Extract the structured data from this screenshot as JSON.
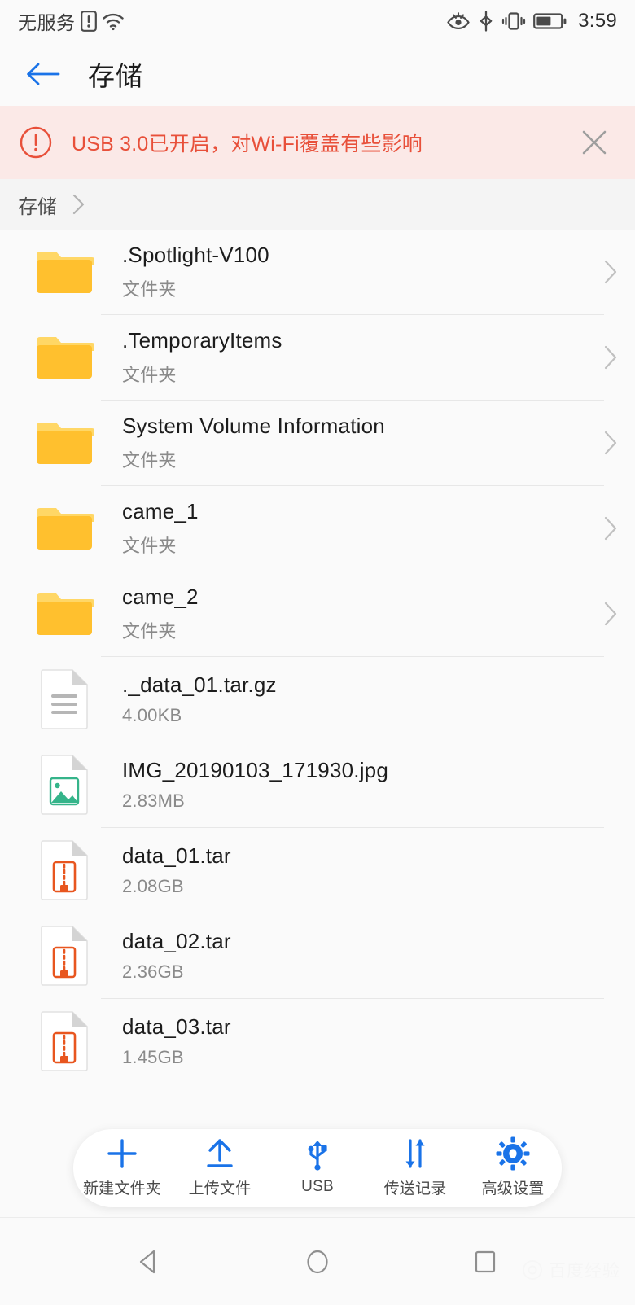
{
  "status_bar": {
    "carrier": "无服务",
    "time": "3:59",
    "icons": [
      "sim-card-alert-icon",
      "wifi-icon",
      "eye-comfort-icon",
      "bluetooth-icon",
      "vibrate-icon",
      "battery-icon"
    ]
  },
  "header": {
    "title": "存储",
    "back_icon": "back-arrow-icon"
  },
  "banner": {
    "message": "USB 3.0已开启，对Wi-Fi覆盖有些影响",
    "alert_icon": "alert-circle-icon",
    "close_icon": "close-icon",
    "text_color": "#e8503a",
    "background_color": "#fbe9e7"
  },
  "breadcrumb": {
    "items": [
      "存储"
    ],
    "chevron_icon": "chevron-right-icon"
  },
  "files": [
    {
      "name": ".Spotlight-V100",
      "sub": "文件夹",
      "kind": "folder",
      "icon": "folder-icon",
      "chevron": true
    },
    {
      "name": ".TemporaryItems",
      "sub": "文件夹",
      "kind": "folder",
      "icon": "folder-icon",
      "chevron": true
    },
    {
      "name": "System Volume Information",
      "sub": "文件夹",
      "kind": "folder",
      "icon": "folder-icon",
      "chevron": true
    },
    {
      "name": "came_1",
      "sub": "文件夹",
      "kind": "folder",
      "icon": "folder-icon",
      "chevron": true
    },
    {
      "name": "came_2",
      "sub": "文件夹",
      "kind": "folder",
      "icon": "folder-icon",
      "chevron": true
    },
    {
      "name": "._data_01.tar.gz",
      "sub": "4.00KB",
      "kind": "generic",
      "icon": "document-file-icon",
      "chevron": false
    },
    {
      "name": "IMG_20190103_171930.jpg",
      "sub": "2.83MB",
      "kind": "image",
      "icon": "image-file-icon",
      "chevron": false
    },
    {
      "name": "data_01.tar",
      "sub": "2.08GB",
      "kind": "archive",
      "icon": "archive-file-icon",
      "chevron": false
    },
    {
      "name": "data_02.tar",
      "sub": "2.36GB",
      "kind": "archive",
      "icon": "archive-file-icon",
      "chevron": false
    },
    {
      "name": "data_03.tar",
      "sub": "1.45GB",
      "kind": "archive",
      "icon": "archive-file-icon",
      "chevron": false
    }
  ],
  "action_bar": {
    "actions": [
      {
        "label": "新建文件夹",
        "icon": "plus-icon"
      },
      {
        "label": "上传文件",
        "icon": "upload-icon"
      },
      {
        "label": "USB",
        "icon": "usb-icon"
      },
      {
        "label": "传送记录",
        "icon": "transfer-records-icon"
      },
      {
        "label": "高级设置",
        "icon": "gear-icon"
      }
    ],
    "accent_color": "#1a73e8"
  },
  "nav_bar": {
    "buttons": [
      {
        "icon": "nav-back-triangle-icon"
      },
      {
        "icon": "nav-home-circle-icon"
      },
      {
        "icon": "nav-recents-square-icon"
      }
    ]
  },
  "watermark": {
    "text": "百度经验"
  },
  "theme": {
    "folder_color": "#ffc02e",
    "folder_tab_color": "#ffd766",
    "archive_color": "#e8561f",
    "image_color": "#35b48a",
    "page_background": "#fafafa"
  }
}
